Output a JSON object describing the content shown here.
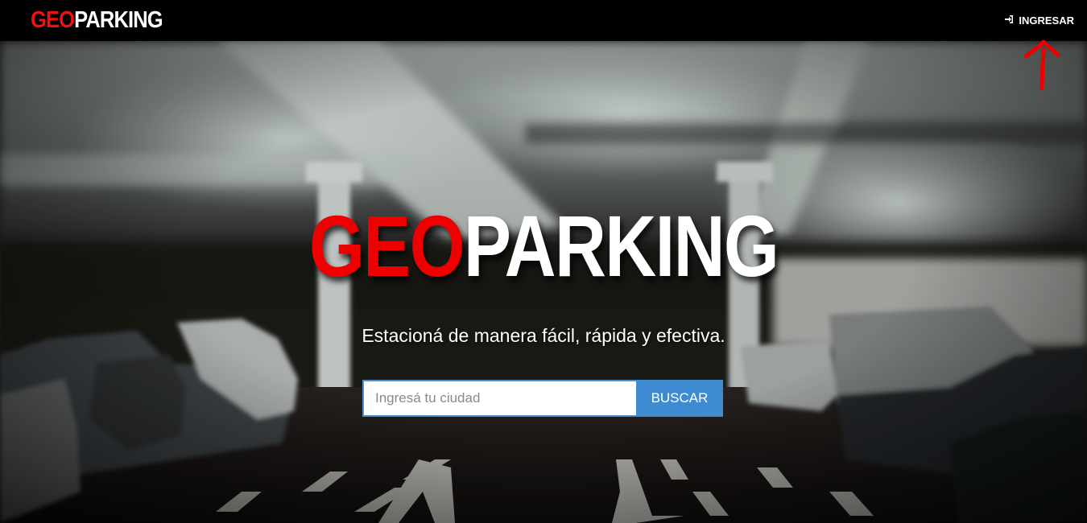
{
  "navbar": {
    "brand_red": "GEO",
    "brand_white": "PARKING",
    "login_label": "INGRESAR",
    "login_icon": "sign-in-icon"
  },
  "hero": {
    "title_red": "GEO",
    "title_white": "PARKING",
    "tagline": "Estacioná de manera fácil, rápida y efectiva.",
    "search": {
      "placeholder": "Ingresá tu ciudad",
      "value": "",
      "button_label": "BUSCAR"
    }
  },
  "colors": {
    "brand_red": "#ee1111",
    "accent_blue": "#3e8bd1",
    "navbar_bg": "#000000"
  }
}
